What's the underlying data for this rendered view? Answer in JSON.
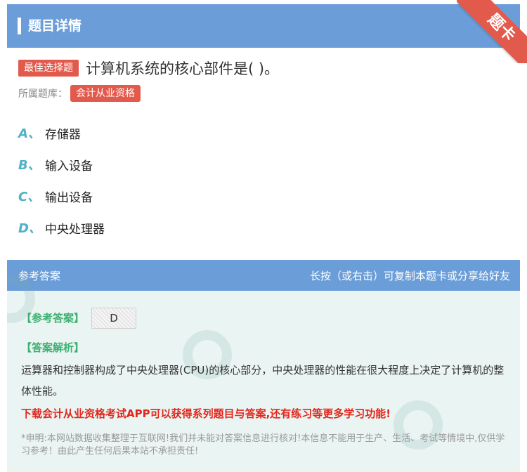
{
  "header": {
    "title": "题目详情",
    "ribbon": "题卡"
  },
  "question": {
    "tag": "最佳选择题",
    "text": "计算机系统的核心部件是( )。",
    "bank_label": "所属题库：",
    "bank_tag": "会计从业资格"
  },
  "options": [
    {
      "letter": "A、",
      "text": "存储器"
    },
    {
      "letter": "B、",
      "text": "输入设备"
    },
    {
      "letter": "C、",
      "text": "输出设备"
    },
    {
      "letter": "D、",
      "text": "中央处理器"
    }
  ],
  "answer": {
    "header_left": "参考答案",
    "header_right": "长按（或右击）可复制本题卡或分享给好友",
    "answer_label": "【参考答案】",
    "answer_value": "D",
    "analysis_label": "【答案解析】",
    "analysis_text": "运算器和控制器构成了中央处理器(CPU)的核心部分，中央处理器的性能在很大程度上决定了计算机的整体性能。",
    "promo": "下载会计从业资格考试APP可以获得系列题目与答案,还有练习等更多学习功能!",
    "disclaimer": "*申明:本网站数据收集整理于互联网!我们并未能对答案信息进行核对!本信息不能用于生产、生活、考试等情境中,仅供学习参考！由此产生任何后果本站不承担责任!"
  },
  "colors": {
    "header_blue": "#6b9ed8",
    "tag_red": "#e25a4c",
    "option_teal": "#4fb0c6",
    "answer_green": "#3db070",
    "promo_red": "#e3261b"
  }
}
